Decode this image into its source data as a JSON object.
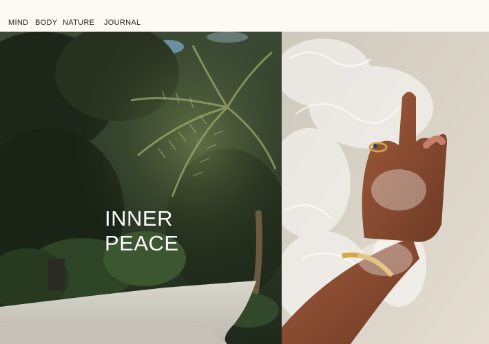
{
  "nav": {
    "items": [
      {
        "label": "MIND"
      },
      {
        "label": "BODY"
      },
      {
        "label": "NATURE"
      },
      {
        "label": "JOURNAL"
      }
    ]
  },
  "hero": {
    "title_line1": "INNER",
    "title_line2": "PEACE"
  },
  "colors": {
    "background": "#fdfaf4",
    "text": "#1d1d1b",
    "hero_text": "#ffffff"
  }
}
